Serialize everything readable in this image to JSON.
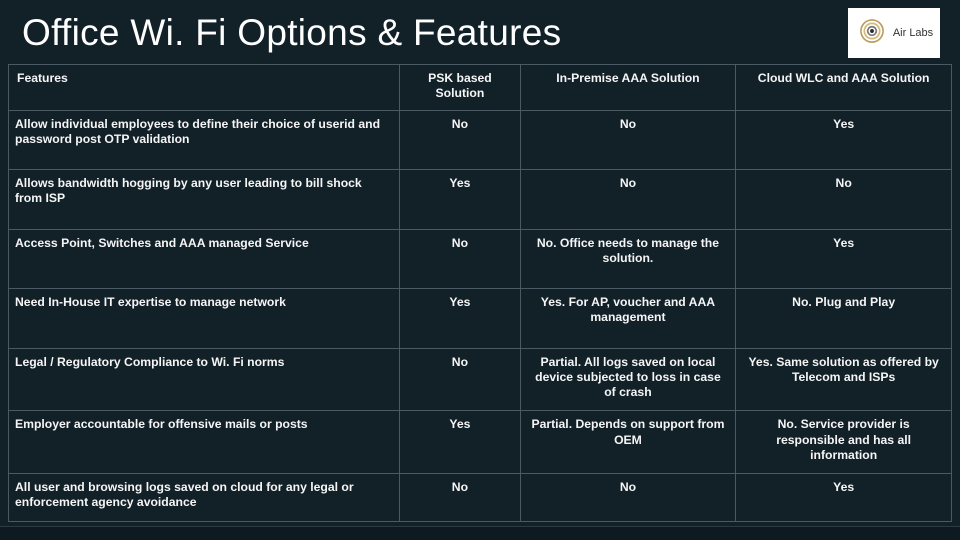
{
  "title": "Office Wi. Fi Options & Features",
  "logo_text": "Air Labs",
  "table": {
    "headers": {
      "features": "Features",
      "psk": "PSK based Solution",
      "premise": "In-Premise  AAA Solution",
      "cloud": "Cloud WLC and AAA Solution"
    },
    "rows": [
      {
        "feature": "Allow individual employees to define their choice of userid and password post OTP validation",
        "psk": "No",
        "premise": "No",
        "cloud": "Yes"
      },
      {
        "feature": "Allows bandwidth hogging by any user leading to bill shock from ISP",
        "psk": "Yes",
        "premise": "No",
        "cloud": "No"
      },
      {
        "feature": "Access Point, Switches and AAA managed Service",
        "psk": "No",
        "premise": "No. Office needs to manage the solution.",
        "cloud": "Yes"
      },
      {
        "feature": "Need In-House IT expertise to manage network",
        "psk": "Yes",
        "premise": "Yes. For AP, voucher and AAA management",
        "cloud": "No. Plug and Play"
      },
      {
        "feature": "Legal / Regulatory Compliance to Wi. Fi norms",
        "psk": "No",
        "premise": "Partial. All logs saved on local device subjected to loss in case of crash",
        "cloud": "Yes. Same solution as offered by Telecom and ISPs"
      },
      {
        "feature": "Employer accountable for offensive mails or posts",
        "psk": "Yes",
        "premise": "Partial. Depends on support from OEM",
        "cloud": "No. Service provider is responsible and has all information"
      },
      {
        "feature": "All user and browsing logs saved on cloud for any legal or enforcement agency avoidance",
        "psk": "No",
        "premise": "No",
        "cloud": "Yes"
      }
    ]
  },
  "chart_data": {
    "type": "table",
    "title": "Office Wi. Fi Options & Features",
    "columns": [
      "Features",
      "PSK based Solution",
      "In-Premise AAA Solution",
      "Cloud WLC and AAA Solution"
    ],
    "rows": [
      [
        "Allow individual employees to define their choice of userid and password post OTP validation",
        "No",
        "No",
        "Yes"
      ],
      [
        "Allows bandwidth hogging by any user leading to bill shock from ISP",
        "Yes",
        "No",
        "No"
      ],
      [
        "Access Point, Switches and AAA managed Service",
        "No",
        "No. Office needs to manage the solution.",
        "Yes"
      ],
      [
        "Need In-House IT expertise to manage network",
        "Yes",
        "Yes. For AP, voucher and AAA management",
        "No. Plug and Play"
      ],
      [
        "Legal / Regulatory Compliance to Wi. Fi norms",
        "No",
        "Partial. All logs saved on local device subjected to loss in case of crash",
        "Yes. Same solution as offered by Telecom and ISPs"
      ],
      [
        "Employer accountable for offensive mails or posts",
        "Yes",
        "Partial. Depends on support from OEM",
        "No. Service provider is responsible and has all information"
      ],
      [
        "All user and browsing logs saved on cloud for any legal or enforcement agency avoidance",
        "No",
        "No",
        "Yes"
      ]
    ]
  }
}
